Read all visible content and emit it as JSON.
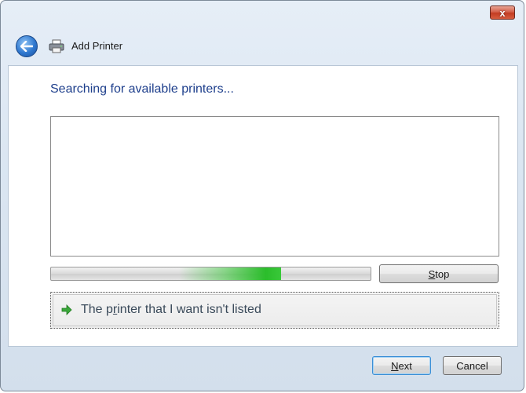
{
  "window": {
    "title": "Add Printer",
    "close_label": "x"
  },
  "content": {
    "heading": "Searching for available printers...",
    "progress": 0.72
  },
  "buttons": {
    "stop_label": "Stop",
    "next_label": "Next",
    "cancel_label": "Cancel"
  },
  "link": {
    "label": "The printer that I want isn't listed"
  },
  "icons": {
    "back": "back-arrow-icon",
    "printer": "printer-icon",
    "close": "close-icon",
    "link_arrow": "green-arrow-icon"
  },
  "colors": {
    "heading": "#1e3f8c",
    "progress_fill": "#2bbd2b",
    "close_button": "#c23c22"
  }
}
